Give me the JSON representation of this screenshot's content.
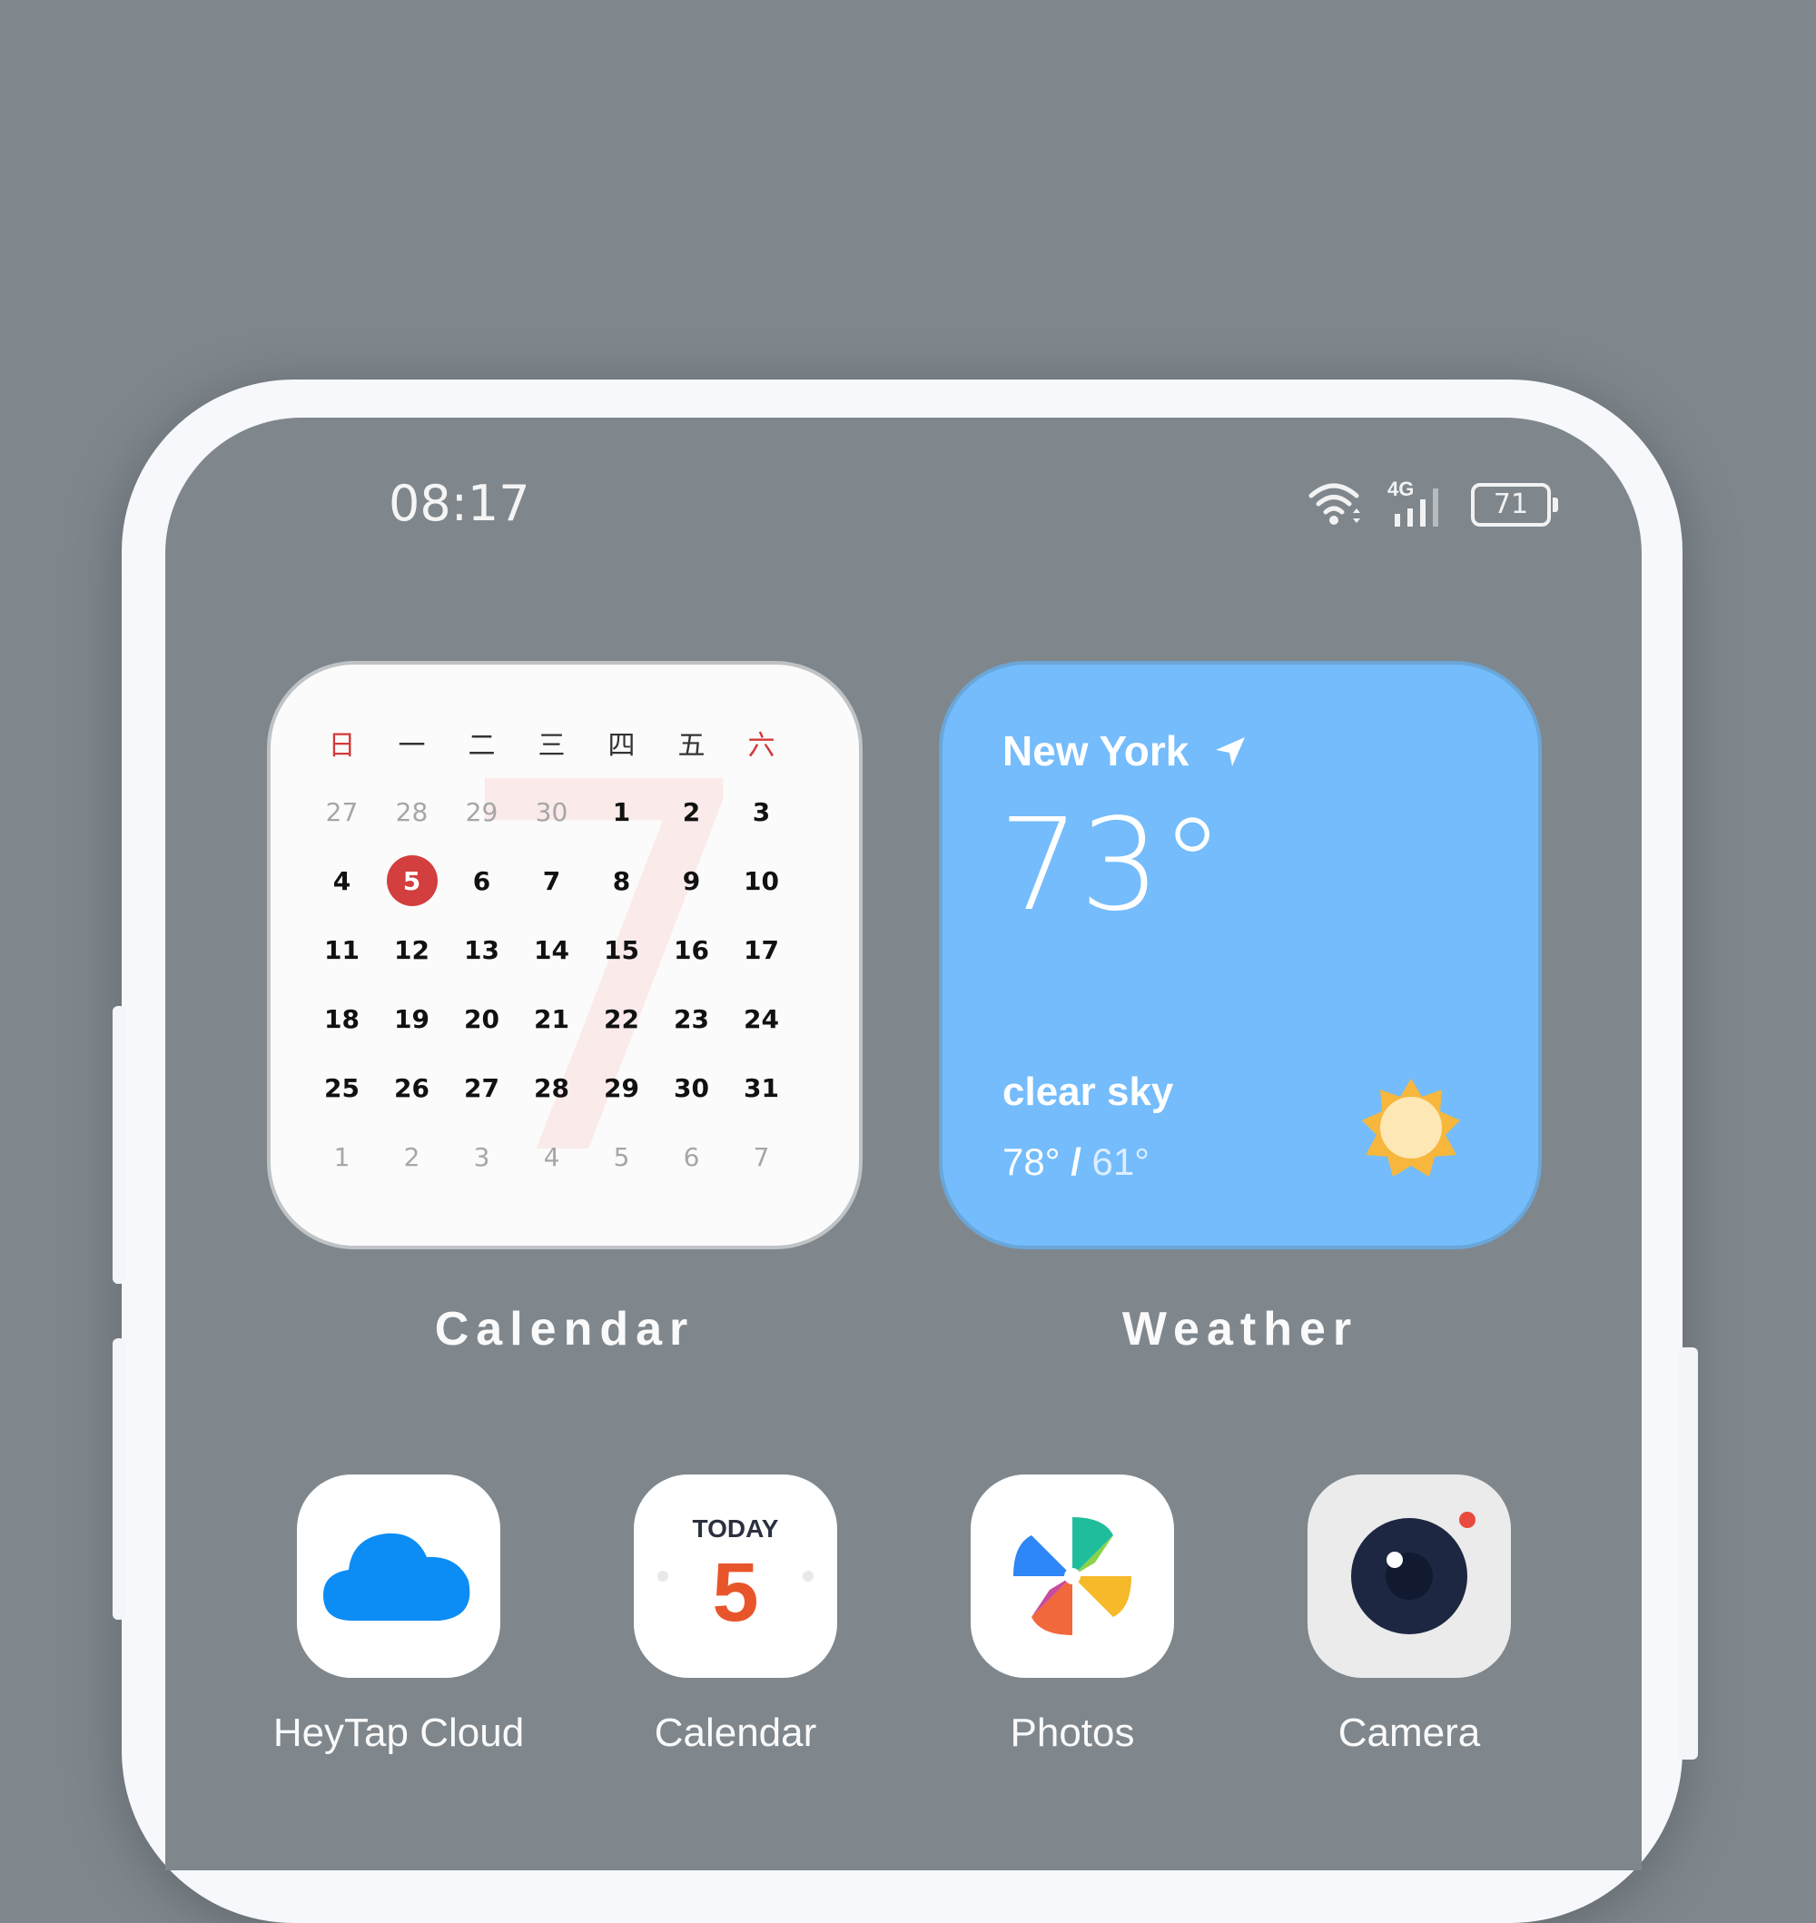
{
  "status_bar": {
    "time": "08:17",
    "network": "4G",
    "battery": "71"
  },
  "calendar_widget": {
    "weekdays": [
      "日",
      "一",
      "二",
      "三",
      "四",
      "五",
      "六"
    ],
    "weeks": [
      [
        "27",
        "28",
        "29",
        "30",
        "1",
        "2",
        "3"
      ],
      [
        "4",
        "5",
        "6",
        "7",
        "8",
        "9",
        "10"
      ],
      [
        "11",
        "12",
        "13",
        "14",
        "15",
        "16",
        "17"
      ],
      [
        "18",
        "19",
        "20",
        "21",
        "22",
        "23",
        "24"
      ],
      [
        "25",
        "26",
        "27",
        "28",
        "29",
        "30",
        "31"
      ],
      [
        "1",
        "2",
        "3",
        "4",
        "5",
        "6",
        "7"
      ]
    ],
    "today": "5",
    "background_numeral": "7",
    "label": "Calendar"
  },
  "weather_widget": {
    "city": "New York",
    "temperature": "73°",
    "condition": "clear sky",
    "high": "78°",
    "separator": "/",
    "low": "61°",
    "label": "Weather",
    "icon": "sun-icon"
  },
  "apps": [
    {
      "label": "HeyTap Cloud",
      "icon": "cloud-icon"
    },
    {
      "label": "Calendar",
      "icon": "calendar-today-icon",
      "icon_text": "TODAY",
      "icon_number": "5"
    },
    {
      "label": "Photos",
      "icon": "pinwheel-icon"
    },
    {
      "label": "Camera",
      "icon": "camera-lens-icon"
    }
  ],
  "colors": {
    "wallpaper": "#7f878d",
    "weather_bg": "#74bcfb",
    "calendar_today": "#d33e3e",
    "cloud_blue": "#0b8df5",
    "calendar_icon_number": "#e8552a"
  }
}
